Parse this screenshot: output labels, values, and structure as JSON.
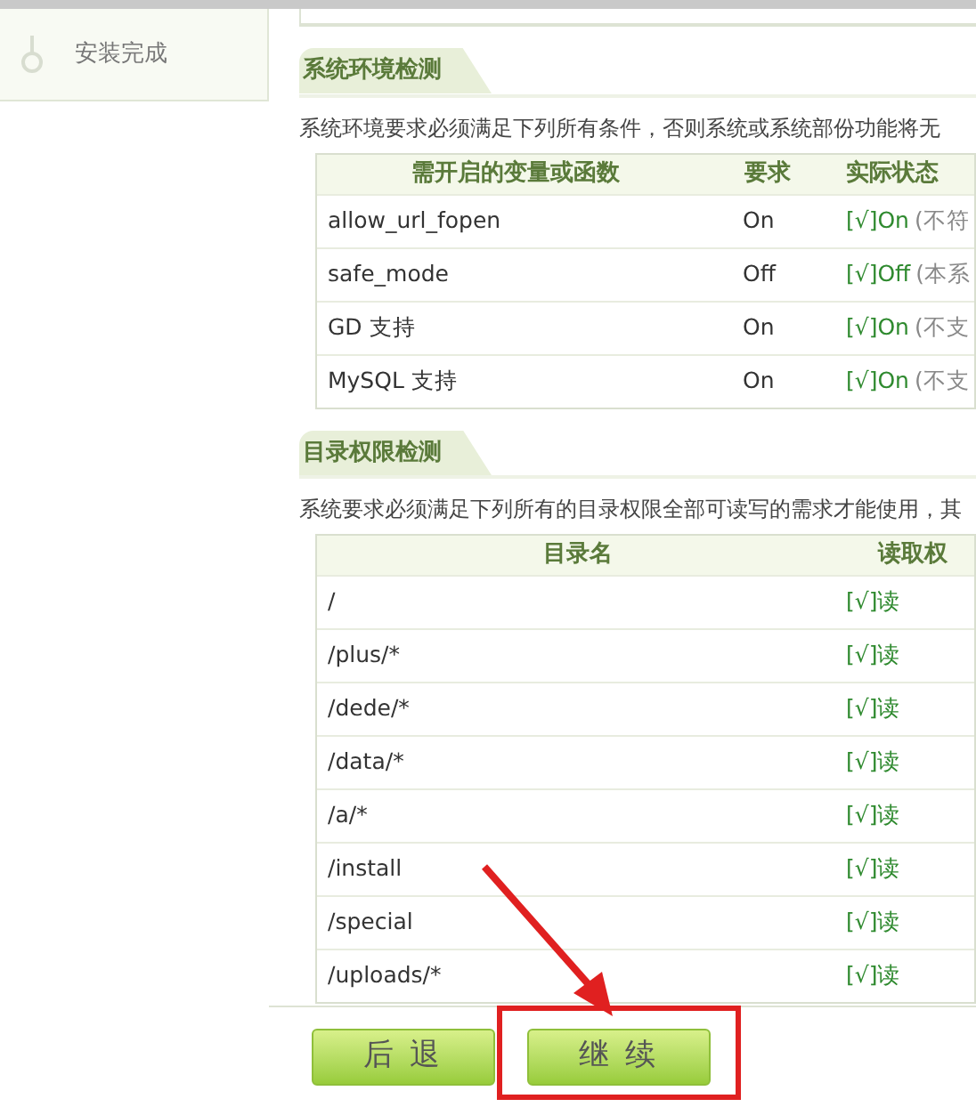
{
  "sidebar": {
    "items": [
      {
        "label": "安装完成"
      }
    ]
  },
  "env_check": {
    "title": "系统环境检测",
    "description": "系统环境要求必须满足下列所有条件，否则系统或系统部份功能将无",
    "columns": [
      "需开启的变量或函数",
      "要求",
      "实际状态"
    ],
    "rows": [
      {
        "name": "allow_url_fopen",
        "required": "On",
        "status": "[√]On",
        "note": "(不符",
        "passed": true
      },
      {
        "name": "safe_mode",
        "required": "Off",
        "status": "[√]Off",
        "note": "(本系",
        "passed": true
      },
      {
        "name": "GD 支持",
        "required": "On",
        "status": "[√]On",
        "note": "(不支",
        "passed": true
      },
      {
        "name": "MySQL 支持",
        "required": "On",
        "status": "[√]On",
        "note": "(不支",
        "passed": true
      }
    ]
  },
  "dir_check": {
    "title": "目录权限检测",
    "description": "系统要求必须满足下列所有的目录权限全部可读写的需求才能使用，其",
    "columns": [
      "目录名",
      "读取权"
    ],
    "rows": [
      {
        "dir": "/",
        "read": "[√]读",
        "passed": true
      },
      {
        "dir": "/plus/*",
        "read": "[√]读",
        "passed": true
      },
      {
        "dir": "/dede/*",
        "read": "[√]读",
        "passed": true
      },
      {
        "dir": "/data/*",
        "read": "[√]读",
        "passed": true
      },
      {
        "dir": "/a/*",
        "read": "[√]读",
        "passed": true
      },
      {
        "dir": "/install",
        "read": "[√]读",
        "passed": true
      },
      {
        "dir": "/special",
        "read": "[√]读",
        "passed": true
      },
      {
        "dir": "/uploads/*",
        "read": "[√]读",
        "passed": true
      }
    ]
  },
  "buttons": [
    {
      "label": "后 退"
    },
    {
      "label": "继 续",
      "highlighted": true
    }
  ]
}
